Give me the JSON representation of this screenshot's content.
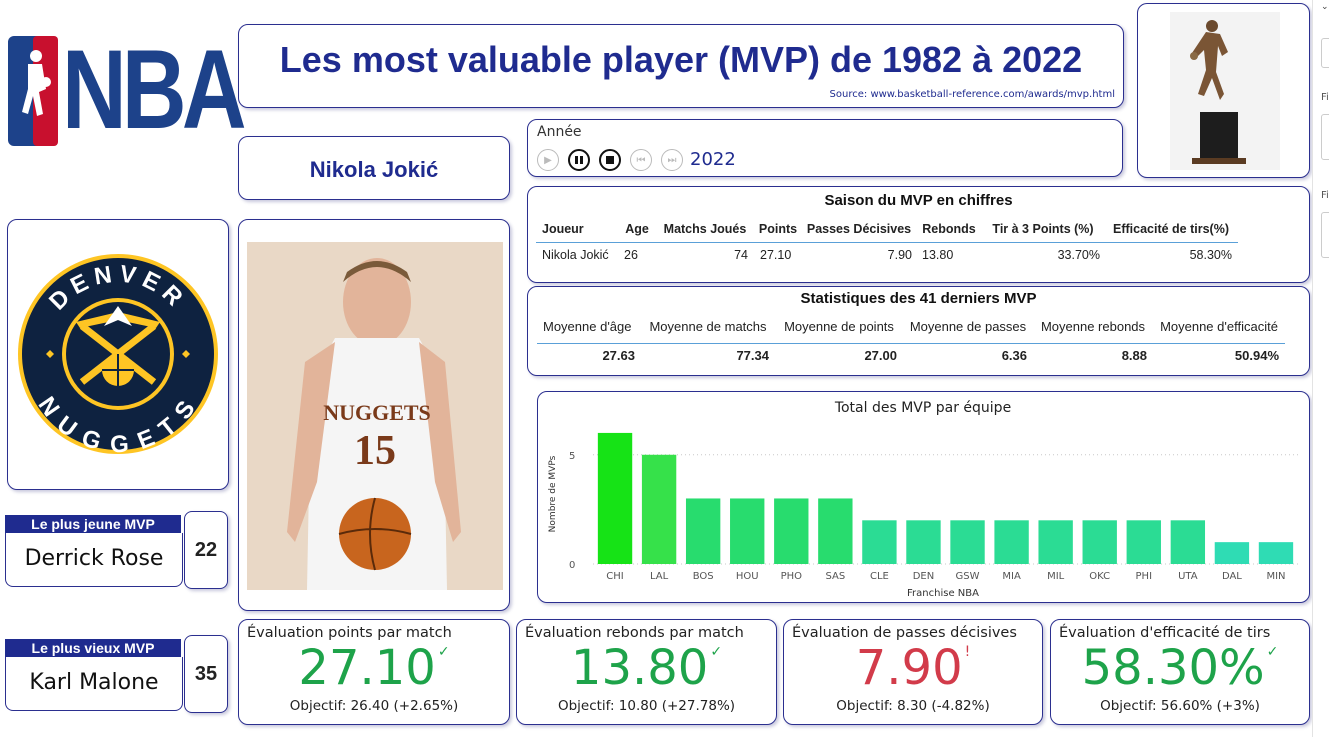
{
  "title": "Les most valuable player (MVP) de 1982 à 2022",
  "source": "Source: www.basketball-reference.com/awards/mvp.html",
  "nba_logo_text": "NBA",
  "player_name": "Nikola Jokić",
  "year_slicer": {
    "label": "Année",
    "value": "2022"
  },
  "season_stats": {
    "title": "Saison du MVP en chiffres",
    "columns": [
      "Joueur",
      "Age",
      "Matchs Joués",
      "Points",
      "Passes Décisives",
      "Rebonds",
      "Tir à 3 Points (%)",
      "Efficacité de tirs(%)"
    ],
    "row": [
      "Nikola Jokić",
      "26",
      "74",
      "27.10",
      "7.90",
      "13.80",
      "33.70%",
      "58.30%"
    ]
  },
  "averages": {
    "title": "Statistiques des 41 derniers MVP",
    "columns": [
      "Moyenne d'âge",
      "Moyenne de matchs",
      "Moyenne de points",
      "Moyenne de passes",
      "Moyenne rebonds",
      "Moyenne d'efficacité"
    ],
    "values": [
      "27.63",
      "77.34",
      "27.00",
      "6.36",
      "8.88",
      "50.94%"
    ]
  },
  "chart_data": {
    "type": "bar",
    "title": "Total des MVP par équipe",
    "xlabel": "Franchise NBA",
    "ylabel": "Nombre de MVPs",
    "categories": [
      "CHI",
      "LAL",
      "BOS",
      "HOU",
      "PHO",
      "SAS",
      "CLE",
      "DEN",
      "GSW",
      "MIA",
      "MIL",
      "OKC",
      "PHI",
      "UTA",
      "DAL",
      "MIN"
    ],
    "values": [
      6,
      5,
      3,
      3,
      3,
      3,
      2,
      2,
      2,
      2,
      2,
      2,
      2,
      2,
      1,
      1
    ],
    "yticks": [
      "0",
      "5"
    ],
    "ylim": [
      0,
      6.5
    ],
    "colors": [
      "#16e316",
      "#36e14a",
      "#28dc6e",
      "#28dc6e",
      "#28dc6e",
      "#28dc6e",
      "#2bdc94",
      "#2bdc94",
      "#2bdc94",
      "#2bdc94",
      "#2bdc94",
      "#2bdc94",
      "#2bdc94",
      "#2bdc94",
      "#2fdcb4",
      "#2fdcb4"
    ],
    "grid": "horizontal-dotted",
    "legend": "none"
  },
  "youngest": {
    "label": "Le plus jeune MVP",
    "name": "Derrick Rose",
    "age": "22"
  },
  "oldest": {
    "label": "Le plus vieux MVP",
    "name": "Karl Malone",
    "age": "35"
  },
  "kpis": [
    {
      "title": "Évaluation points par match",
      "value": "27.10",
      "mark": "✓",
      "status": "green",
      "goal": "Objectif: 26.40 (+2.65%)"
    },
    {
      "title": "Évaluation rebonds par match",
      "value": "13.80",
      "mark": "✓",
      "status": "green",
      "goal": "Objectif: 10.80 (+27.78%)"
    },
    {
      "title": "Évaluation de passes décisives",
      "value": "7.90",
      "mark": "!",
      "status": "red",
      "goal": "Objectif: 8.30 (-4.82%)"
    },
    {
      "title": "Évaluation d'efficacité de tirs",
      "value": "58.30%",
      "mark": "✓",
      "status": "green",
      "goal": "Objectif: 56.60% (+3%)"
    }
  ],
  "team_logo": {
    "top_text": "DENVER",
    "bottom_text": "NUGGETS"
  },
  "jersey_text": {
    "team": "NUGGETS",
    "number": "15"
  },
  "colors": {
    "accent": "#1f2b8f",
    "green": "#1ea34a",
    "red": "#d23b4a",
    "nba_blue": "#1d428a",
    "nba_red": "#c8102e"
  },
  "side_panel": {
    "label1": "Fi",
    "label2": "Fi"
  }
}
